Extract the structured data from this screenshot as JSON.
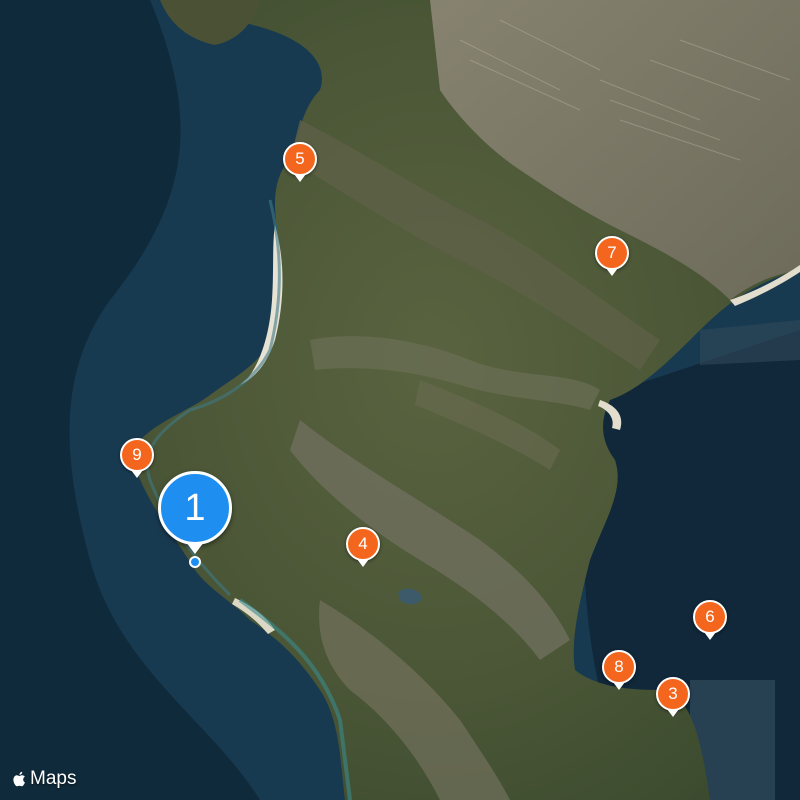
{
  "map": {
    "type": "satellite",
    "attribution": "Maps",
    "colors": {
      "ocean_deep": "#0f2a3b",
      "ocean_shelf": "#193b52",
      "land": "#4d5a3a",
      "mountain": "#6b6a55",
      "sand": "#e6e2d4",
      "pin_orange": "#f4661d",
      "pin_blue": "#1e8ff0"
    },
    "markers": [
      {
        "label": "1",
        "style": "large",
        "color": "#1e8ff0"
      },
      {
        "label": "3",
        "style": "small",
        "color": "#f4661d"
      },
      {
        "label": "4",
        "style": "small",
        "color": "#f4661d"
      },
      {
        "label": "5",
        "style": "small",
        "color": "#f4661d"
      },
      {
        "label": "6",
        "style": "small",
        "color": "#f4661d"
      },
      {
        "label": "7",
        "style": "small",
        "color": "#f4661d"
      },
      {
        "label": "8",
        "style": "small",
        "color": "#f4661d"
      },
      {
        "label": "9",
        "style": "small",
        "color": "#f4661d"
      }
    ]
  }
}
